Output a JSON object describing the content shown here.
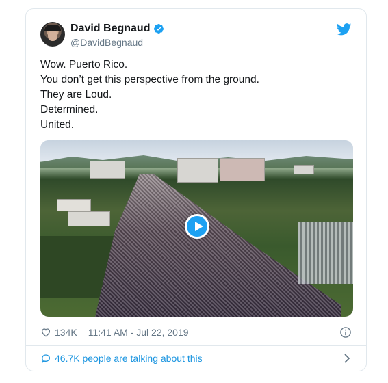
{
  "tweet": {
    "author": {
      "display_name": "David Begnaud",
      "handle": "@DavidBegnaud",
      "verified": true
    },
    "text_lines": [
      "Wow. Puerto Rico.",
      "You don’t get this perspective from the ground.",
      "They are Loud.",
      "Determined.",
      "United."
    ],
    "stats": {
      "likes": "134K",
      "timestamp": "11:41 AM - Jul 22, 2019"
    },
    "conversation": {
      "label": "46.7K people are talking about this"
    }
  },
  "colors": {
    "brand_blue": "#1da1f2",
    "link_blue": "#1b95e0",
    "muted_text": "#657786",
    "border": "#e1e8ed"
  },
  "icons": [
    "verified-badge-icon",
    "twitter-bird-icon",
    "play-icon",
    "heart-icon",
    "info-icon",
    "speech-bubble-icon",
    "chevron-right-icon"
  ]
}
